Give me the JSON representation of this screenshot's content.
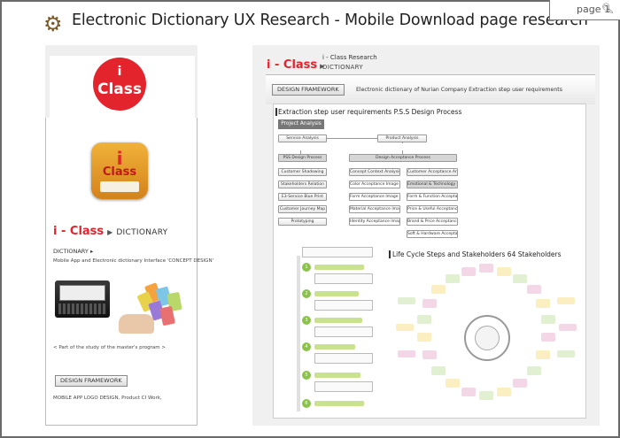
{
  "header": {
    "title": "Electronic Dictionary UX Research - Mobile Download page research",
    "page_label": "page 1"
  },
  "left": {
    "logo_i": "i",
    "logo_class": "Class",
    "appicon_i": "i",
    "appicon_class": "Class",
    "brand": "i - Class",
    "brand_dict": "DICTIONARY",
    "subtitle": "DICTIONARY",
    "subtitle_arrow": "▸",
    "description": "Mobile App and Electronic dictionary Interface 'CONCEPT DESIGN'",
    "caption": "< Part of the study of the master's program >",
    "button": "DESIGN FRAMEWORK",
    "footer": "MOBILE APP LOGO DESIGN, Product CI Work,"
  },
  "right": {
    "brand": "i - Class",
    "research": "i - Class Research",
    "dictionary": "DICTIONARY",
    "button": "DESIGN FRAMEWORK",
    "bar_text": "Electronic dictionary of Nurian Company  Extraction step user requirements",
    "doc_heading": "Extraction step user requirements   P.S.S Design Process",
    "project_analysis": "Project Analysis",
    "service_analysis": "Service Analysis",
    "product_analysis": "Product Analysis",
    "pss_design_process": "PSS Design Process",
    "design_acceptance_process": "Design Acceptance Process",
    "left_col": [
      "Customer Shadowing",
      "Stakeholders Relation",
      "E3-Service Blue Print",
      "Customer Journey Map",
      "Prototyping"
    ],
    "mid_col": [
      "Concept Context Analysis",
      "Color Acceptance Image Zone",
      "Form Acceptance Image Zone",
      "Material Acceptance Image Zone",
      "Identity Acceptance Image Zone"
    ],
    "right_col": [
      "Customer Acceptance Analysis",
      "Emotional & Technology Gap",
      "Form & Function Acceptance Gap",
      "Price & Useful Acceptance Gap",
      "Brand & Price Acceptance Gap",
      "Soft & Hardware Acceptance Gap"
    ],
    "lifecycle_title": "Life Cycle Steps and Stakeholders    64 Stakeholders"
  }
}
